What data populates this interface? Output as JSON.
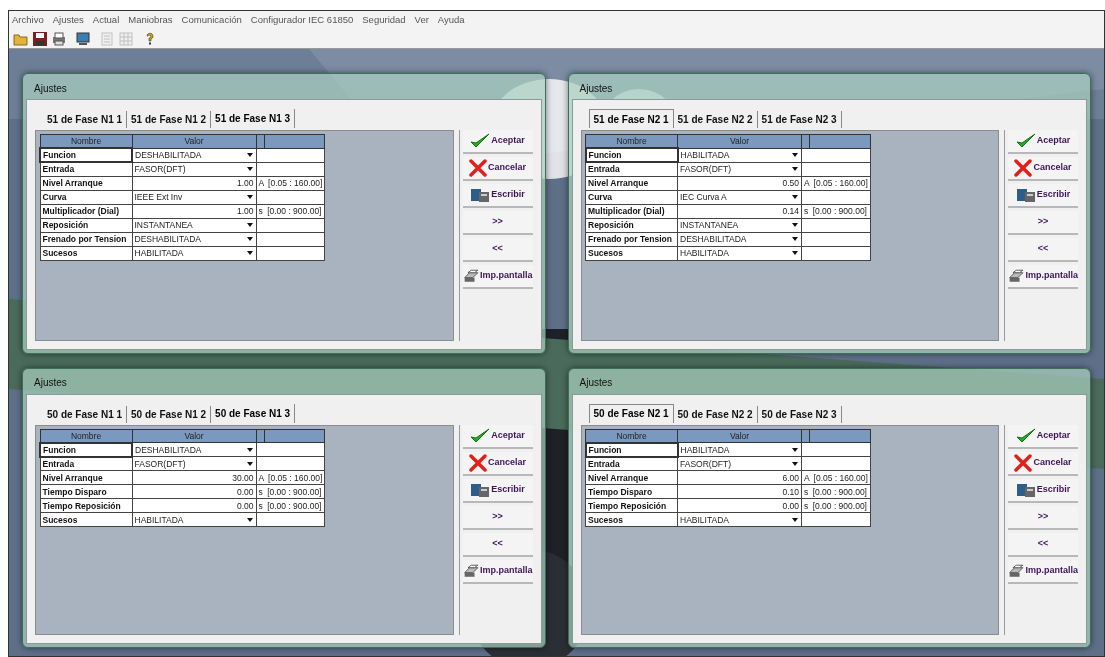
{
  "menu": [
    "Archivo",
    "Ajustes",
    "Actual",
    "Maniobras",
    "Comunicación",
    "Configurador IEC 61850",
    "Seguridad",
    "Ver",
    "Ayuda"
  ],
  "toolbar": [
    {
      "kind": "open",
      "disabled": false
    },
    {
      "kind": "save",
      "disabled": false
    },
    {
      "kind": "print",
      "disabled": false
    },
    {
      "kind": "monitor",
      "disabled": false
    },
    {
      "kind": "doc",
      "disabled": true
    },
    {
      "kind": "grid",
      "disabled": true
    },
    {
      "kind": "help",
      "disabled": false
    }
  ],
  "dialogs": [
    {
      "title": "Ajustes",
      "tabs": [
        {
          "label": "51 de Fase N1 1",
          "selected": false
        },
        {
          "label": "51 de Fase N1 2",
          "selected": false
        },
        {
          "label": "51 de Fase N1 3",
          "selected": true
        }
      ],
      "columns": [
        "Nombre",
        "Valor"
      ],
      "rows": [
        {
          "name": "Funcion",
          "kind": "select",
          "value": "DESHABILITADA",
          "focused": true
        },
        {
          "name": "Entrada",
          "kind": "select",
          "value": "FASOR(DFT)",
          "focused": false
        },
        {
          "name": "Nivel Arranque",
          "kind": "number",
          "value": "1.00",
          "unit": "A",
          "range": "[0.05 : 160.00]",
          "focused": false
        },
        {
          "name": "Curva",
          "kind": "select",
          "value": "IEEE Ext Inv",
          "focused": false
        },
        {
          "name": "Multiplicador (Dial)",
          "kind": "number",
          "value": "1.00",
          "unit": "s",
          "range": "[0.00 : 900.00]",
          "focused": false
        },
        {
          "name": "Reposición",
          "kind": "select",
          "value": "INSTANTANEA",
          "focused": false
        },
        {
          "name": "Frenado por Tension",
          "kind": "select",
          "value": "DESHABILITADA",
          "focused": false
        },
        {
          "name": "Sucesos",
          "kind": "select",
          "value": "HABILITADA",
          "focused": false
        }
      ],
      "buttons": [
        {
          "kind": "accept",
          "label": "Aceptar"
        },
        {
          "kind": "cancel",
          "label": "Cancelar"
        },
        {
          "kind": "write",
          "label": "Escribir"
        },
        {
          "kind": "next",
          "label": ">>"
        },
        {
          "kind": "prev",
          "label": "<<"
        },
        {
          "kind": "print",
          "label": "Imp.pantalla"
        }
      ]
    },
    {
      "title": "Ajustes",
      "tabs": [
        {
          "label": "51 de Fase N2 1",
          "selected": true
        },
        {
          "label": "51 de Fase N2 2",
          "selected": false
        },
        {
          "label": "51 de Fase N2 3",
          "selected": false
        }
      ],
      "columns": [
        "Nombre",
        "Valor"
      ],
      "rows": [
        {
          "name": "Funcion",
          "kind": "select",
          "value": "HABILITADA",
          "focused": true
        },
        {
          "name": "Entrada",
          "kind": "select",
          "value": "FASOR(DFT)",
          "focused": false
        },
        {
          "name": "Nivel Arranque",
          "kind": "number",
          "value": "0.50",
          "unit": "A",
          "range": "[0.05 : 160.00]",
          "focused": false
        },
        {
          "name": "Curva",
          "kind": "select",
          "value": "IEC Curva A",
          "focused": false
        },
        {
          "name": "Multiplicador (Dial)",
          "kind": "number",
          "value": "0.14",
          "unit": "s",
          "range": "[0.00 : 900.00]",
          "focused": false
        },
        {
          "name": "Reposición",
          "kind": "select",
          "value": "INSTANTANEA",
          "focused": false
        },
        {
          "name": "Frenado por Tension",
          "kind": "select",
          "value": "DESHABILITADA",
          "focused": false
        },
        {
          "name": "Sucesos",
          "kind": "select",
          "value": "HABILITADA",
          "focused": false
        }
      ],
      "buttons": [
        {
          "kind": "accept",
          "label": "Aceptar"
        },
        {
          "kind": "cancel",
          "label": "Cancelar"
        },
        {
          "kind": "write",
          "label": "Escribir"
        },
        {
          "kind": "next",
          "label": ">>"
        },
        {
          "kind": "prev",
          "label": "<<"
        },
        {
          "kind": "print",
          "label": "Imp.pantalla"
        }
      ]
    },
    {
      "title": "Ajustes",
      "tabs": [
        {
          "label": "50 de Fase N1 1",
          "selected": false
        },
        {
          "label": "50 de Fase N1 2",
          "selected": false
        },
        {
          "label": "50 de Fase N1 3",
          "selected": true
        }
      ],
      "columns": [
        "Nombre",
        "Valor"
      ],
      "rows": [
        {
          "name": "Funcion",
          "kind": "select",
          "value": "DESHABILITADA",
          "focused": true
        },
        {
          "name": "Entrada",
          "kind": "select",
          "value": "FASOR(DFT)",
          "focused": false
        },
        {
          "name": "Nivel Arranque",
          "kind": "number",
          "value": "30.00",
          "unit": "A",
          "range": "[0.05 : 160.00]",
          "focused": false
        },
        {
          "name": "Tiempo Disparo",
          "kind": "number",
          "value": "0.00",
          "unit": "s",
          "range": "[0.00 : 900.00]",
          "focused": false
        },
        {
          "name": "Tiempo Reposición",
          "kind": "number",
          "value": "0.00",
          "unit": "s",
          "range": "[0.00 : 900.00]",
          "focused": false
        },
        {
          "name": "Sucesos",
          "kind": "select",
          "value": "HABILITADA",
          "focused": false
        }
      ],
      "buttons": [
        {
          "kind": "accept",
          "label": "Aceptar"
        },
        {
          "kind": "cancel",
          "label": "Cancelar"
        },
        {
          "kind": "write",
          "label": "Escribir"
        },
        {
          "kind": "next",
          "label": ">>"
        },
        {
          "kind": "prev",
          "label": "<<"
        },
        {
          "kind": "print",
          "label": "Imp.pantalla"
        }
      ]
    },
    {
      "title": "Ajustes",
      "tabs": [
        {
          "label": "50 de Fase N2 1",
          "selected": true
        },
        {
          "label": "50 de Fase N2 2",
          "selected": false
        },
        {
          "label": "50 de Fase N2 3",
          "selected": false
        }
      ],
      "columns": [
        "Nombre",
        "Valor"
      ],
      "rows": [
        {
          "name": "Funcion",
          "kind": "select",
          "value": "HABILITADA",
          "focused": true
        },
        {
          "name": "Entrada",
          "kind": "select",
          "value": "FASOR(DFT)",
          "focused": false
        },
        {
          "name": "Nivel Arranque",
          "kind": "number",
          "value": "6.00",
          "unit": "A",
          "range": "[0.05 : 160.00]",
          "focused": false
        },
        {
          "name": "Tiempo Disparo",
          "kind": "number",
          "value": "0.10",
          "unit": "s",
          "range": "[0.00 : 900.00]",
          "focused": false
        },
        {
          "name": "Tiempo Reposición",
          "kind": "number",
          "value": "0.00",
          "unit": "s",
          "range": "[0.00 : 900.00]",
          "focused": false
        },
        {
          "name": "Sucesos",
          "kind": "select",
          "value": "HABILITADA",
          "focused": false
        }
      ],
      "buttons": [
        {
          "kind": "accept",
          "label": "Aceptar"
        },
        {
          "kind": "cancel",
          "label": "Cancelar"
        },
        {
          "kind": "write",
          "label": "Escribir"
        },
        {
          "kind": "next",
          "label": ">>"
        },
        {
          "kind": "prev",
          "label": "<<"
        },
        {
          "kind": "print",
          "label": "Imp.pantalla"
        }
      ]
    }
  ]
}
